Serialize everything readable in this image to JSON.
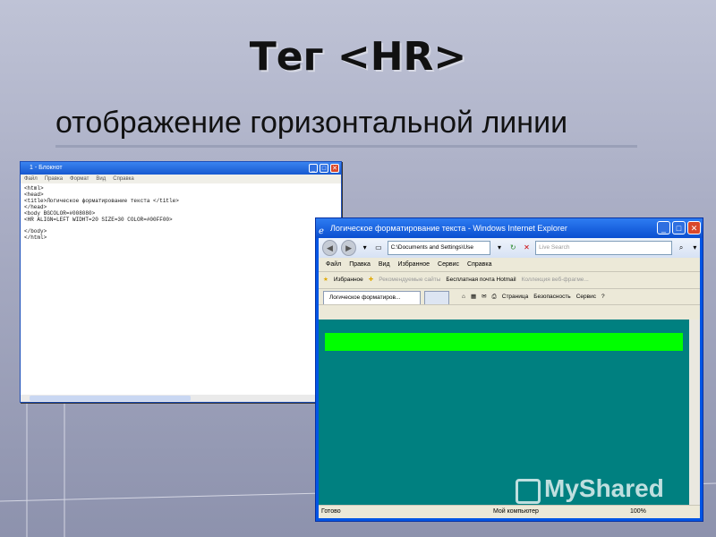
{
  "slide": {
    "title": "Тег <HR>",
    "subtitle": "отображение горизонтальной линии"
  },
  "notepad": {
    "title": "1 - Блокнот",
    "menu": [
      "Файл",
      "Правка",
      "Формат",
      "Вид",
      "Справка"
    ],
    "code": "<html>\n<head>\n<title>Логическое форматирование текста </title>\n</head>\n<body BGCOLOR=#008080>\n<HR ALIGN=LEFT WIDHT=20 SIZE=30 COLOR=#00FF00>\n\n</body>\n</html>"
  },
  "ie": {
    "title": "Логическое форматирование текста - Windows Internet Explorer",
    "address": "C:\\Documents and Settings\\Use",
    "search_placeholder": "Live Search",
    "menu": [
      "Файл",
      "Правка",
      "Вид",
      "Избранное",
      "Сервис",
      "Справка"
    ],
    "favorites": {
      "label": "Избранное",
      "items": [
        "Рекомендуемые сайты",
        "Бесплатная почта Hotmail",
        "Коллекция веб-фрагме..."
      ]
    },
    "tab_label": "Логическое форматиров...",
    "tools": [
      "Страница",
      "Безопасность",
      "Сервис"
    ],
    "page": {
      "bg_color": "#008080",
      "hr_color": "#00ff00"
    },
    "status": {
      "left": "Готово",
      "zone": "Мой компьютер",
      "zoom": "100%"
    }
  },
  "watermark": "MyShared"
}
